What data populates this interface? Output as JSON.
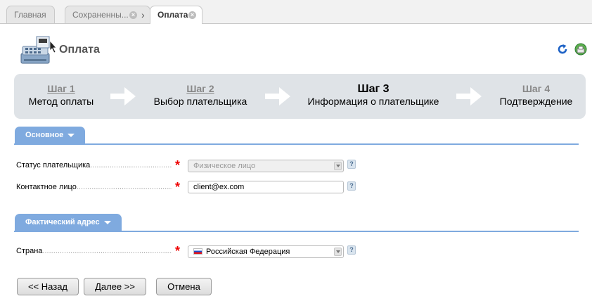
{
  "tabs": [
    {
      "label": "Главная",
      "active": false
    },
    {
      "label": "Сохраненны...",
      "active": false
    },
    {
      "label": "Оплата",
      "active": true
    }
  ],
  "header": {
    "title": "Оплата"
  },
  "steps": [
    {
      "num": "Шаг 1",
      "name": "Метод оплаты",
      "state": "done"
    },
    {
      "num": "Шаг 2",
      "name": "Выбор плательщика",
      "state": "done"
    },
    {
      "num": "Шаг 3",
      "name": "Информация о плательщике",
      "state": "current"
    },
    {
      "num": "Шаг 4",
      "name": "Подтверждение",
      "state": "future"
    }
  ],
  "sections": {
    "main": {
      "title": "Основное",
      "fields": {
        "payer_status": {
          "label": "Статус плательщика",
          "value": "Физическое лицо"
        },
        "contact": {
          "label": "Контактное лицо",
          "value": "client@ex.com"
        }
      }
    },
    "address": {
      "title": "Фактический адрес",
      "fields": {
        "country": {
          "label": "Страна",
          "value": "Российская Федерация"
        }
      }
    }
  },
  "help_mark": "?",
  "required_mark": "*",
  "buttons": {
    "back": "<< Назад",
    "next": "Далее >>",
    "cancel": "Отмена"
  },
  "colors": {
    "accent": "#7faadf",
    "steps_bg": "#dfe3e7",
    "required": "#e00000"
  }
}
